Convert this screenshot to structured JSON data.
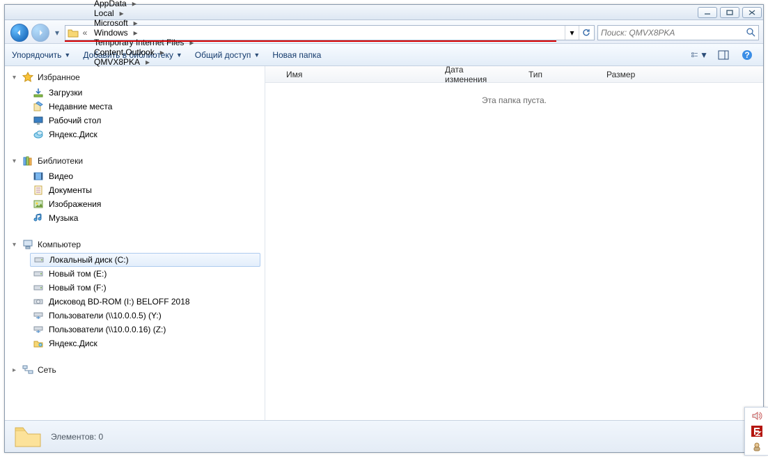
{
  "window_controls": {
    "min": "min",
    "max": "max",
    "close": "close"
  },
  "breadcrumbs": [
    "AppData",
    "Local",
    "Microsoft",
    "Windows",
    "Temporary Internet Files",
    "Content.Outlook",
    "QMVX8PKA"
  ],
  "search": {
    "placeholder": "Поиск: QMVX8PKA"
  },
  "toolbar": {
    "organize": "Упорядочить",
    "add_library": "Добавить в библиотеку",
    "share": "Общий доступ",
    "new_folder": "Новая папка"
  },
  "sidebar": {
    "favorites": {
      "header": "Избранное",
      "items": [
        "Загрузки",
        "Недавние места",
        "Рабочий стол",
        "Яндекс.Диск"
      ]
    },
    "libraries": {
      "header": "Библиотеки",
      "items": [
        "Видео",
        "Документы",
        "Изображения",
        "Музыка"
      ]
    },
    "computer": {
      "header": "Компьютер",
      "items": [
        "Локальный диск (C:)",
        "Новый том (E:)",
        "Новый том (F:)",
        "Дисковод BD-ROM (I:) BELOFF 2018",
        "Пользователи (\\\\10.0.0.5) (Y:)",
        "Пользователи (\\\\10.0.0.16) (Z:)",
        "Яндекс.Диск"
      ],
      "selected_index": 0
    },
    "network": {
      "header": "Сеть"
    }
  },
  "columns": [
    "Имя",
    "Дата изменения",
    "Тип",
    "Размер"
  ],
  "empty_text": "Эта папка пуста.",
  "status": {
    "text": "Элементов: 0"
  }
}
